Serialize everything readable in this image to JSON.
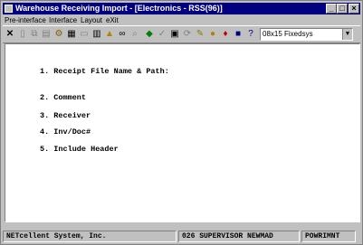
{
  "window": {
    "title": "Warehouse Receiving Import - [Electronics - RSS(96)]",
    "controls": {
      "minimize": "_",
      "maximize": "□",
      "close": "×"
    }
  },
  "menu": {
    "items": [
      "Pre-interface",
      "Interface",
      "Layout",
      "eXit"
    ]
  },
  "toolbar": {
    "font_selector": "08x15 Fixedsys",
    "icons": [
      "close-x",
      "blank-page",
      "copy",
      "paste",
      "gear",
      "settings",
      "window",
      "report",
      "warning",
      "binoculars",
      "magnifier",
      "clipboard",
      "export",
      "calculator",
      "refresh",
      "edit",
      "chip",
      "help-book",
      "save",
      "help"
    ]
  },
  "screen": {
    "fields": [
      "1. Receipt File Name & Path:",
      "2. Comment",
      "3. Receiver",
      "4. Inv/Doc#",
      "5. Include Header"
    ]
  },
  "status": {
    "company": "NETcellent System, Inc.",
    "user": "026 SUPERVISOR NEWMAD",
    "program": "POWRIMNT"
  }
}
